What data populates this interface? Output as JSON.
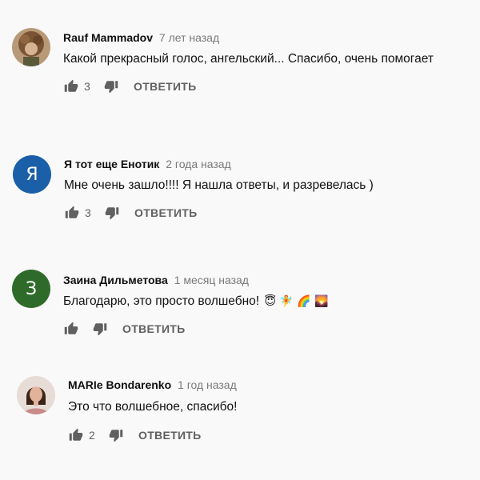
{
  "comments": [
    {
      "author": "Rauf Mammadov",
      "time": "7 лет назад",
      "text": "Какой прекрасный голос, ангельский... Спасибо, очень помогает",
      "likes": "3",
      "reply_label": "ОТВЕТИТЬ",
      "avatar": {
        "type": "photo",
        "color": "#8a6a4a"
      }
    },
    {
      "author": "Я тот еще Енотик",
      "time": "2 года назад",
      "text": "Мне очень зашло!!!! Я нашла ответы, и разревелась )",
      "likes": "3",
      "reply_label": "ОТВЕТИТЬ",
      "avatar": {
        "type": "letter",
        "letter": "Я",
        "color": "#1a5fa8"
      }
    },
    {
      "author": "Заина Дильметова",
      "time": "1 месяц назад",
      "text": "Благодарю, это просто волшебно!",
      "emojis": "😇 🧚 🌈 🌄",
      "likes": "",
      "reply_label": "ОТВЕТИТЬ",
      "avatar": {
        "type": "letter",
        "letter": "З",
        "color": "#2e6b2a"
      }
    },
    {
      "author": "MARIe Bondarenko",
      "time": "1 год назад",
      "text": "Это что волшебное, спасибо!",
      "likes": "2",
      "reply_label": "ОТВЕТИТЬ",
      "avatar": {
        "type": "photo",
        "color": "#c9a99a"
      }
    }
  ],
  "colors": {
    "text": "#111111",
    "secondary": "#606060",
    "background": "#f9f9f9"
  },
  "icons": {
    "like": "thumb-up-icon",
    "dislike": "thumb-down-icon"
  }
}
